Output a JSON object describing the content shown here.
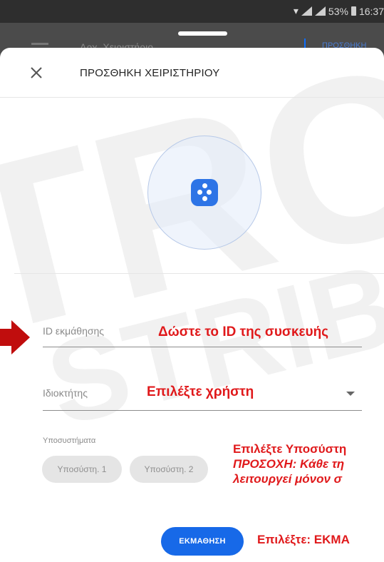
{
  "status_bar": {
    "battery": "53%",
    "time": "16:37"
  },
  "background_screen": {
    "title": "Αρχ. Χειριστήριο",
    "action": "ΠΡΟΣΘΗΚΗ"
  },
  "sheet": {
    "title": "ΠΡΟΣΘΗΚΗ ΧΕΙΡΙΣΤΗΡΙΟΥ"
  },
  "form": {
    "id_label": "ID εκμάθησης",
    "owner_label": "Ιδιοκτήτης",
    "subsystems_label": "Υποσυστήματα",
    "subsystems": [
      "Υποσύστη. 1",
      "Υποσύστη. 2"
    ],
    "learn_button": "ΕΚΜΑΘΗΣΗ"
  },
  "annotations": {
    "id_hint": "Δώστε το ID της συσκευής",
    "owner_hint": "Επιλέξτε χρήστη",
    "subsystem_hint_1": "Επιλέξτε Υποσύστη",
    "subsystem_hint_2": "ΠΡΟΣΟΧΗ: Κάθε τη",
    "subsystem_hint_3": "λειτουργεί μόνον σ",
    "learn_hint": "Επιλέξτε: ΕΚΜΑ"
  },
  "watermark": {
    "line1": "TRC",
    "line2": "STRIBU"
  },
  "colors": {
    "accent": "#1769e8",
    "annotation": "#e0191b",
    "arrow": "#c00d0d",
    "status_bar": "#2e2e2e"
  },
  "icons": [
    "close-icon",
    "remote-control-icon",
    "dropdown-arrow-icon",
    "wifi-icon",
    "signal-icon",
    "battery-icon"
  ]
}
